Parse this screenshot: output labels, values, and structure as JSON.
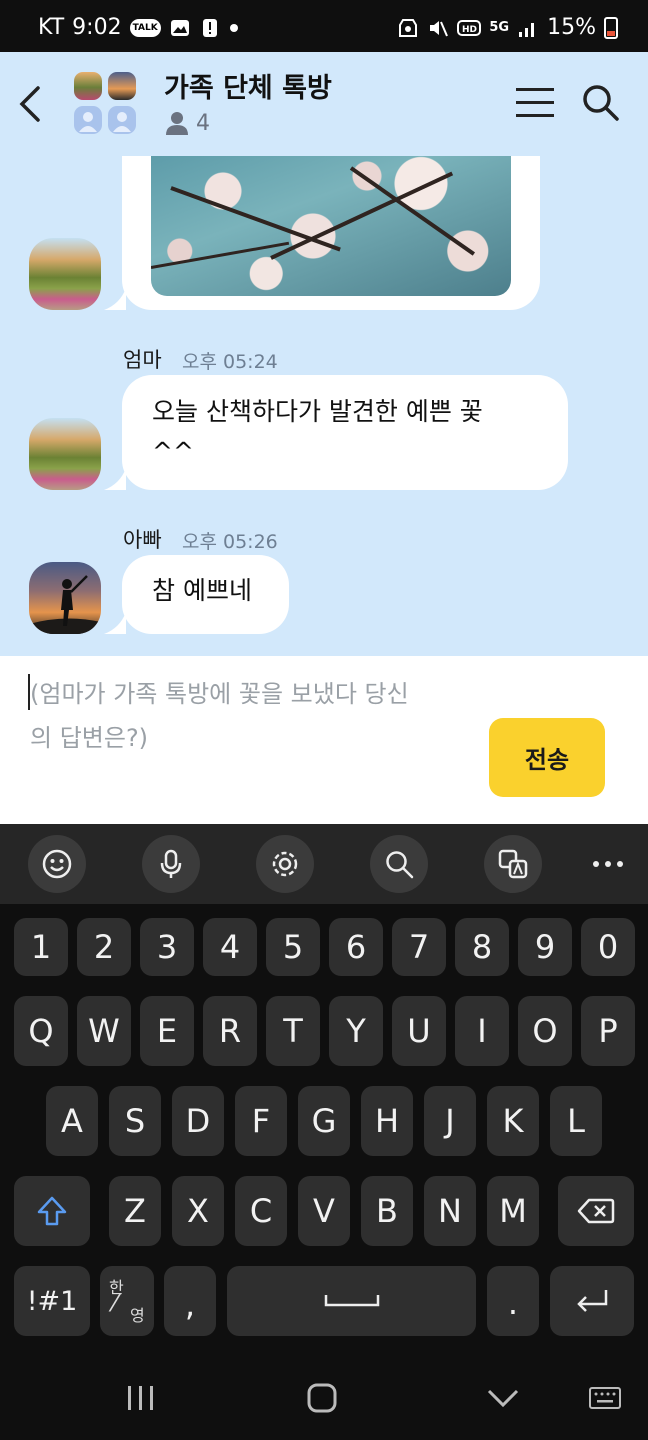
{
  "status": {
    "carrier": "KT",
    "time": "9:02",
    "battery": "15%",
    "network": "5G"
  },
  "header": {
    "title": "가족 단체 톡방",
    "member_count": "4"
  },
  "messages": [
    {
      "sender": "엄마",
      "time": "오후 05:24",
      "text_line1": "오늘 산책하다가 발견한 예쁜 꽃",
      "text_line2": "^^"
    },
    {
      "sender": "아빠",
      "time": "오후 05:26",
      "text": "참 예쁘네"
    }
  ],
  "input": {
    "placeholder_line1": "(엄마가 가족 톡방에 꽃을 보냈다 당신",
    "placeholder_line2": "의 답변은?)"
  },
  "send_label": "전송",
  "keyboard": {
    "numbers": [
      "1",
      "2",
      "3",
      "4",
      "5",
      "6",
      "7",
      "8",
      "9",
      "0"
    ],
    "row1": [
      "Q",
      "W",
      "E",
      "R",
      "T",
      "Y",
      "U",
      "I",
      "O",
      "P"
    ],
    "row2": [
      "A",
      "S",
      "D",
      "F",
      "G",
      "H",
      "J",
      "K",
      "L"
    ],
    "row3": [
      "Z",
      "X",
      "C",
      "V",
      "B",
      "N",
      "M"
    ],
    "symbols_label": "!#1",
    "lang_top": "한",
    "lang_bottom": "영",
    "comma": ",",
    "period": "."
  },
  "colors": {
    "chat_bg": "#d2e8fb",
    "send": "#fad12d",
    "keyboard_bg": "#0f0f0f",
    "key": "#2f2f2f"
  }
}
